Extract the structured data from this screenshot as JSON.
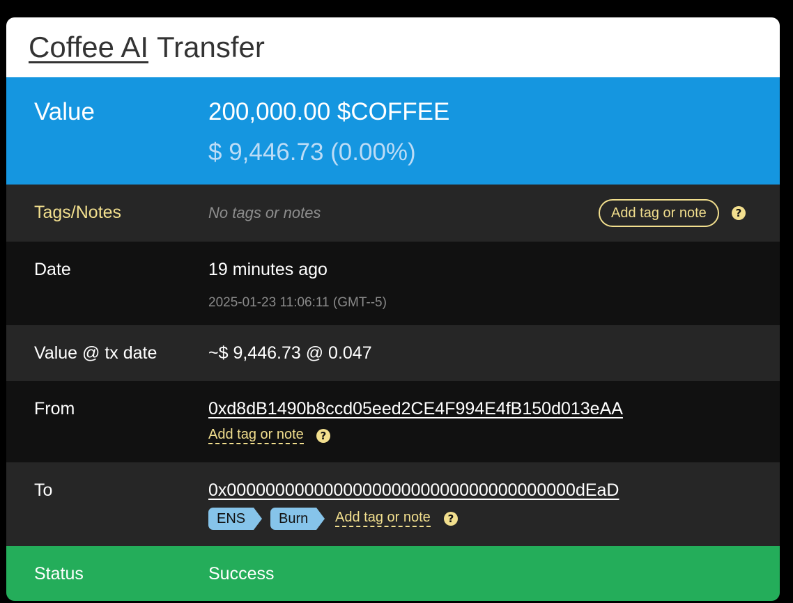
{
  "header": {
    "token_name": "Coffee AI",
    "title_suffix": "Transfer"
  },
  "value": {
    "label": "Value",
    "amount": "200,000.00 $COFFEE",
    "usd": "$ 9,446.73 (0.00%)"
  },
  "tags_notes": {
    "label": "Tags/Notes",
    "empty_text": "No tags or notes",
    "add_button": "Add tag or note",
    "help": "?"
  },
  "date": {
    "label": "Date",
    "relative": "19 minutes ago",
    "absolute": "2025-01-23 11:06:11 (GMT--5)"
  },
  "value_at_tx": {
    "label": "Value @ tx date",
    "value": "~$ 9,446.73 @ 0.047"
  },
  "from": {
    "label": "From",
    "address": "0xd8dB1490b8ccd05eed2CE4F994E4fB150d013eAA",
    "add_tag": "Add tag or note",
    "help": "?"
  },
  "to": {
    "label": "To",
    "address": "0x000000000000000000000000000000000000dEaD",
    "tags": [
      "ENS",
      "Burn"
    ],
    "add_tag": "Add tag or note",
    "help": "?"
  },
  "status": {
    "label": "Status",
    "value": "Success"
  },
  "colors": {
    "value_bg": "#1596e0",
    "status_bg": "#24ad5a",
    "accent_yellow": "#f2df8e",
    "tag_pill": "#86c4ea"
  }
}
